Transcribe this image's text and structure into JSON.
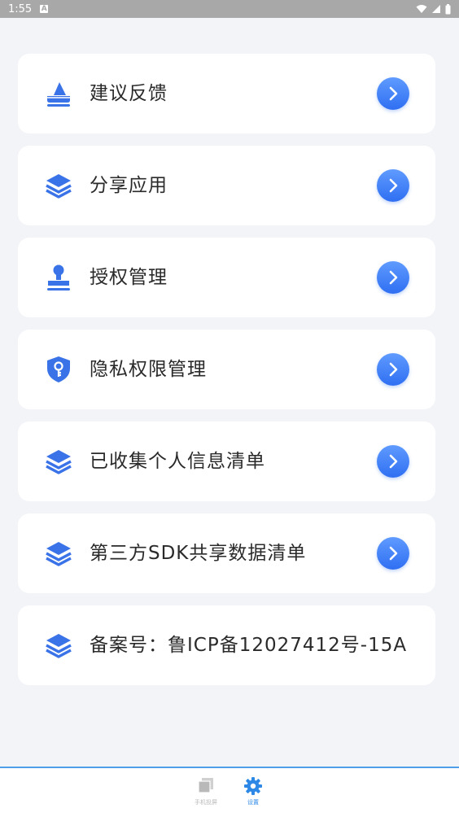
{
  "status_bar": {
    "time": "1:55",
    "notification_icon": "A"
  },
  "menu": [
    {
      "label": "建议反馈",
      "icon": "feedback-icon"
    },
    {
      "label": "分享应用",
      "icon": "layers-icon"
    },
    {
      "label": "授权管理",
      "icon": "stamp-icon"
    },
    {
      "label": "隐私权限管理",
      "icon": "shield-key-icon"
    },
    {
      "label": "已收集个人信息清单",
      "icon": "layers-icon"
    },
    {
      "label": "第三方SDK共享数据清单",
      "icon": "layers-icon"
    },
    {
      "label": "备案号：鲁ICP备12027412号-15A",
      "icon": "layers-icon"
    }
  ],
  "bottom_nav": {
    "tabs": [
      {
        "label": "手机投屏",
        "icon": "mirror-icon",
        "active": false
      },
      {
        "label": "设置",
        "icon": "gear-icon",
        "active": true
      }
    ]
  },
  "colors": {
    "accent": "#2f6ff2",
    "background": "#f3f4f8",
    "active_tab": "#2d88e6",
    "inactive_tab": "#b9b9b9"
  }
}
